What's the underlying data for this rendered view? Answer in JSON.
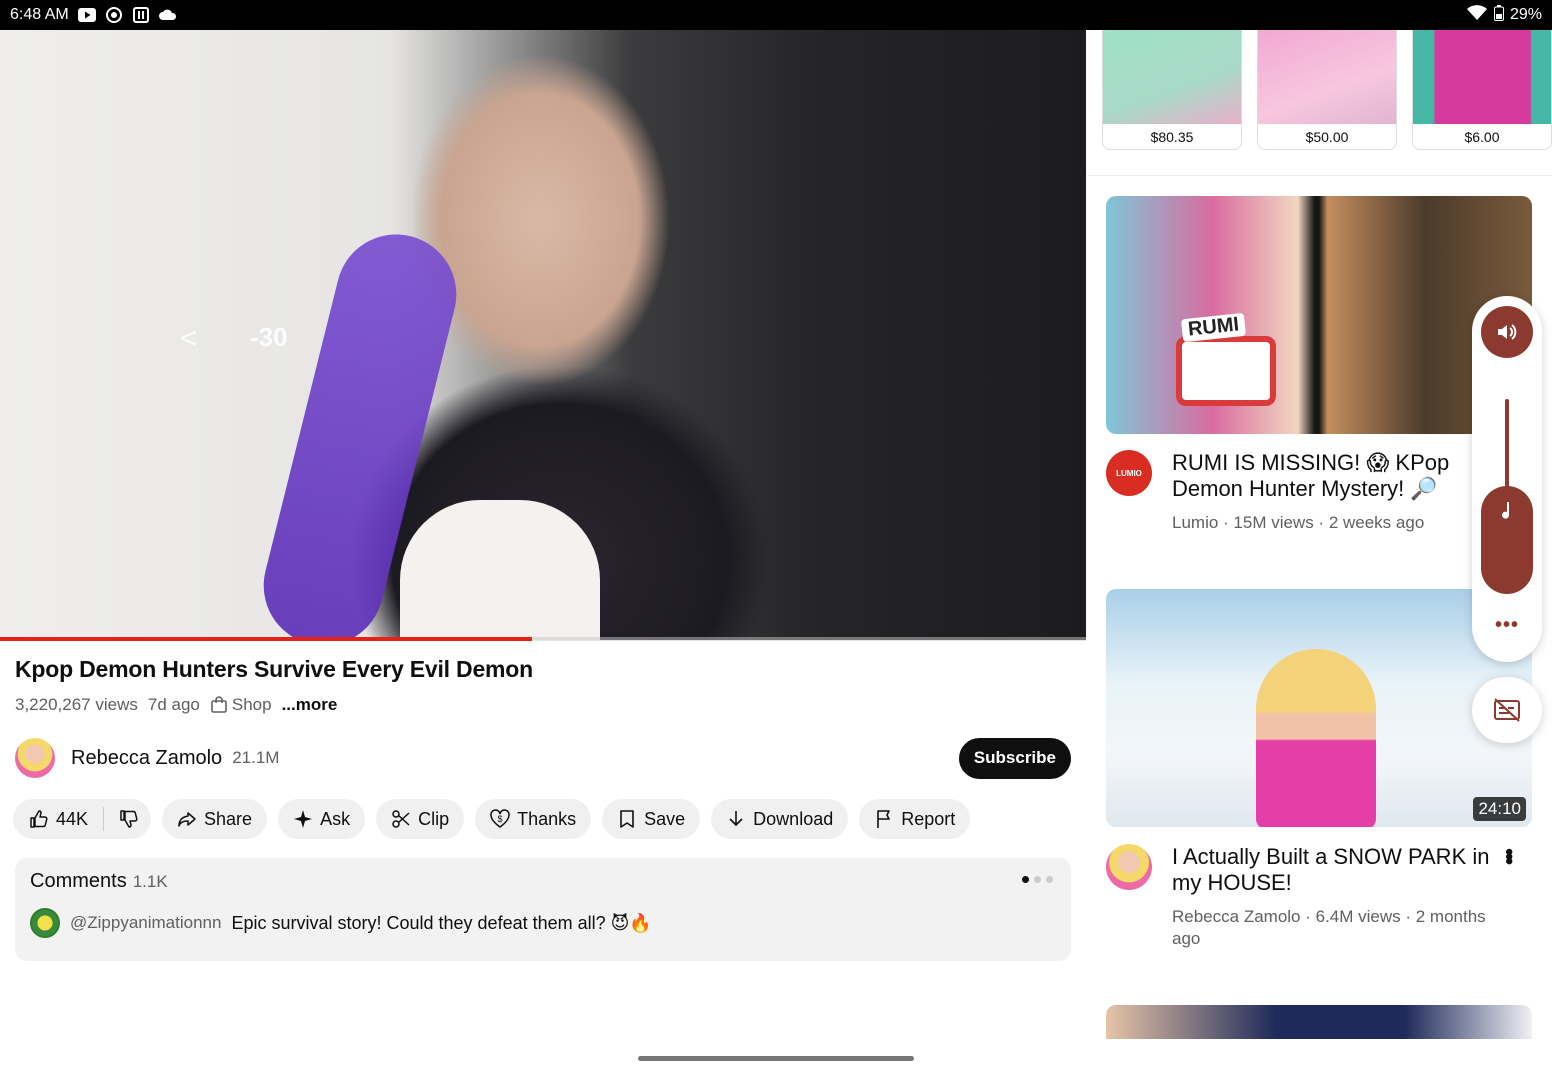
{
  "status_bar": {
    "time": "6:48 AM",
    "battery": "29%",
    "icons": [
      "youtube-icon",
      "chrome-icon",
      "app-icon",
      "cloud-icon",
      "wifi-icon",
      "battery-icon"
    ]
  },
  "player": {
    "seek_back_glyph": "<",
    "seek_amount": "-30",
    "progress_fraction": 0.49
  },
  "video": {
    "title": "Kpop Demon Hunters Survive Every Evil Demon",
    "views": "3,220,267 views",
    "age": "7d ago",
    "shop_label": "Shop",
    "more_label": "...more"
  },
  "channel": {
    "name": "Rebecca Zamolo",
    "subscribers": "21.1M",
    "subscribe_label": "Subscribe"
  },
  "actions": {
    "likes": "44K",
    "share": "Share",
    "ask": "Ask",
    "clip": "Clip",
    "thanks": "Thanks",
    "save": "Save",
    "download": "Download",
    "report": "Report"
  },
  "comments": {
    "title": "Comments",
    "count": "1.1K",
    "top_author": "@Zippyanimationnn",
    "top_text": "Epic survival story! Could they defeat them all? 😈🔥"
  },
  "shop_items": [
    {
      "price": "$80.35"
    },
    {
      "price": "$50.00"
    },
    {
      "price": "$6.00"
    }
  ],
  "recommended": [
    {
      "thumb_label": "RUMI",
      "title": "RUMI IS MISSING! 😱 KPop Demon Hunter Mystery! 🔎",
      "meta": "Lumio · 15M views · 2 weeks ago",
      "channel_avatar": "LUMIO"
    },
    {
      "duration": "24:10",
      "title": "I Actually Built a SNOW PARK in my HOUSE!",
      "meta": "Rebecca Zamolo · 6.4M views · 2 months ago"
    }
  ],
  "overlay": {
    "more_label": "•••"
  },
  "colors": {
    "accent_red": "#e62117",
    "volume_brown": "#8c3a30",
    "chip_bg": "#f0f0f0"
  }
}
